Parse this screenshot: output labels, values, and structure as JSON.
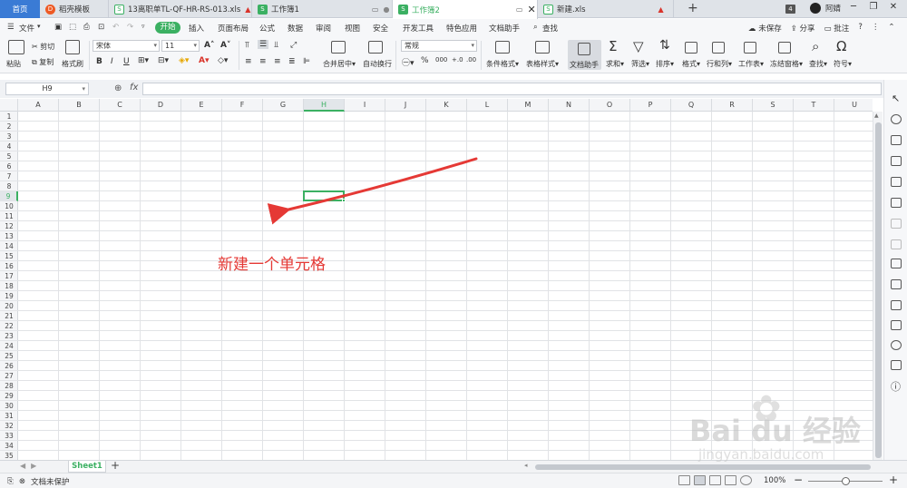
{
  "tabs": [
    {
      "label": "首页"
    },
    {
      "label": "稻壳模板"
    },
    {
      "label": "13离职单TL-QF-HR-RS-013.xls"
    },
    {
      "label": "工作簿1"
    },
    {
      "label": "工作簿2"
    },
    {
      "label": "新建.xls"
    }
  ],
  "tab_count": "4",
  "user_name": "阿婧",
  "menu": {
    "file": "文件",
    "start": "开始",
    "items": [
      "插入",
      "页面布局",
      "公式",
      "数据",
      "审阅",
      "视图",
      "安全",
      "开发工具",
      "特色应用",
      "文档助手"
    ],
    "search": "查找",
    "unsaved": "未保存",
    "share": "分享",
    "comment": "批注"
  },
  "ribbon": {
    "paste": "粘贴",
    "cut": "剪切",
    "copy": "复制",
    "format_painter": "格式刷",
    "font_name": "宋体",
    "font_size": "11",
    "merge_center": "合并居中",
    "auto_wrap": "自动换行",
    "number_format": "常规",
    "conditional_format": "条件格式",
    "table_style": "表格样式",
    "doc_helper": "文档助手",
    "sum": "求和",
    "filter": "筛选",
    "sort": "排序",
    "format": "格式",
    "row_col": "行和列",
    "worksheet": "工作表",
    "freeze": "冻结窗格",
    "find": "查找",
    "symbol": "符号"
  },
  "formula_bar": {
    "name_box": "H9",
    "fx": "fx"
  },
  "columns": [
    "A",
    "B",
    "C",
    "D",
    "E",
    "F",
    "G",
    "H",
    "I",
    "J",
    "K",
    "L",
    "M",
    "N",
    "O",
    "P",
    "Q",
    "R",
    "S",
    "T",
    "U"
  ],
  "selected_column": "H",
  "rows": [
    "1",
    "2",
    "3",
    "4",
    "5",
    "6",
    "7",
    "8",
    "9",
    "10",
    "11",
    "12",
    "13",
    "14",
    "15",
    "16",
    "17",
    "18",
    "19",
    "20",
    "21",
    "22",
    "23",
    "24",
    "25",
    "26",
    "27",
    "28",
    "29",
    "30",
    "31",
    "32",
    "33",
    "34",
    "35"
  ],
  "selected_row": "9",
  "annotation": "新建一个单元格",
  "sheet_tab": "Sheet1",
  "status": {
    "doc_protect": "文档未保护",
    "zoom": "100%"
  },
  "watermark": {
    "logo": "Bai du 经验",
    "url": "jingyan.baidu.com"
  },
  "colors": {
    "accent": "#3bb062",
    "annotation": "#e53935",
    "home_tab": "#3a7bd5"
  }
}
